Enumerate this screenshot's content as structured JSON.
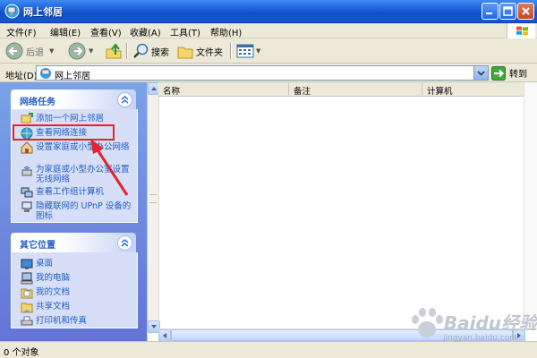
{
  "window": {
    "title": "网上邻居"
  },
  "menu": [
    "文件(F)",
    "编辑(E)",
    "查看(V)",
    "收藏(A)",
    "工具(T)",
    "帮助(H)"
  ],
  "toolbar": {
    "back": "后退",
    "search": "搜索",
    "folders": "文件夹"
  },
  "address": {
    "label": "地址(D)",
    "value": "网上邻居",
    "go": "转到"
  },
  "tasks_panel": {
    "title": "网络任务",
    "items": [
      {
        "label": "添加一个网上邻居",
        "icon": "add-network-place-icon"
      },
      {
        "label": "查看网络连接",
        "icon": "network-connections-icon"
      },
      {
        "label": "设置家庭或小型办公网络",
        "icon": "home-network-setup-icon"
      },
      {
        "label": "为家庭或小型办公室设置无线网络",
        "icon": "wireless-network-icon"
      },
      {
        "label": "查看工作组计算机",
        "icon": "workgroup-computers-icon"
      },
      {
        "label": "隐藏联网的 UPnP 设备的图标",
        "icon": "upnp-device-icon"
      }
    ]
  },
  "places_panel": {
    "title": "其它位置",
    "items": [
      {
        "label": "桌面",
        "icon": "desktop-icon"
      },
      {
        "label": "我的电脑",
        "icon": "my-computer-icon"
      },
      {
        "label": "我的文档",
        "icon": "my-documents-icon"
      },
      {
        "label": "共享文档",
        "icon": "shared-documents-icon"
      },
      {
        "label": "打印机和传真",
        "icon": "printers-faxes-icon"
      }
    ]
  },
  "list": {
    "columns": [
      "名称",
      "备注",
      "计算机"
    ]
  },
  "status": {
    "text": "0 个对象"
  },
  "watermark": {
    "text": "Baidu经验",
    "sub": "jingyan.baidu.com"
  },
  "colors": {
    "title_bar": "#0d4fc8",
    "task_link": "#215dc6",
    "highlight": "#e5232a"
  }
}
